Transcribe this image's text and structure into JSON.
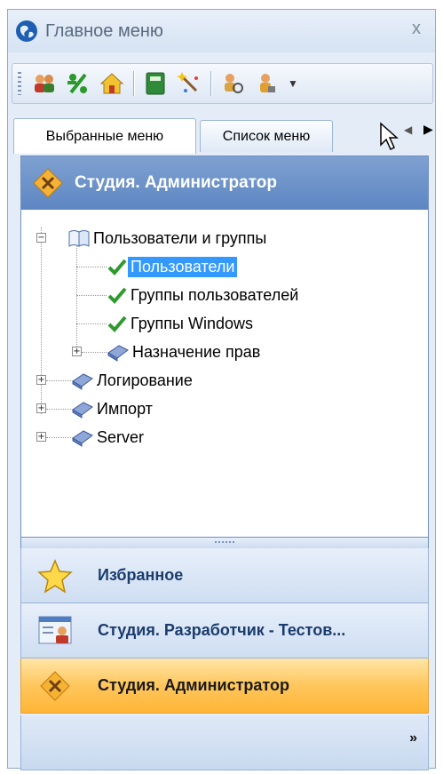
{
  "window": {
    "title": "Главное меню",
    "close_glyph": "x"
  },
  "toolbar": {
    "icons": [
      "users-icon",
      "percent-icon",
      "home-icon",
      "book-icon",
      "magic-wand-icon",
      "find-user-icon",
      "user-lock-icon"
    ],
    "dropdown_glyph": "▼"
  },
  "tabs": {
    "items": [
      {
        "label": "Выбранные меню",
        "active": true
      },
      {
        "label": "Список меню",
        "active": false
      }
    ],
    "scroll_left": "◀",
    "scroll_right": "▶"
  },
  "panel": {
    "title": "Студия. Администратор"
  },
  "tree": {
    "nodes": [
      {
        "label": "Пользователи и группы",
        "expander": "−",
        "icon": "open-book-icon"
      },
      {
        "label": "Пользователи",
        "icon": "checkmark-icon",
        "selected": true
      },
      {
        "label": "Группы пользователей",
        "icon": "checkmark-icon"
      },
      {
        "label": "Группы Windows",
        "icon": "checkmark-icon"
      },
      {
        "label": "Назначение прав",
        "expander": "+",
        "icon": "closed-book-icon"
      },
      {
        "label": "Логирование",
        "expander": "+",
        "icon": "closed-book-icon"
      },
      {
        "label": "Импорт",
        "expander": "+",
        "icon": "closed-book-icon"
      },
      {
        "label": "Server",
        "expander": "+",
        "icon": "closed-book-icon"
      }
    ]
  },
  "navigation": {
    "items": [
      {
        "label": "Избранное",
        "icon": "star-icon"
      },
      {
        "label": "Студия. Разработчик - Тестов...",
        "icon": "developer-card-icon"
      },
      {
        "label": "Студия. Администратор",
        "icon": "admin-tools-icon",
        "active": true
      }
    ],
    "overflow_glyph": "»"
  },
  "colors": {
    "header_blue": "#6a90c8",
    "selection_blue": "#3399ff",
    "active_orange": "#ffc65c"
  }
}
